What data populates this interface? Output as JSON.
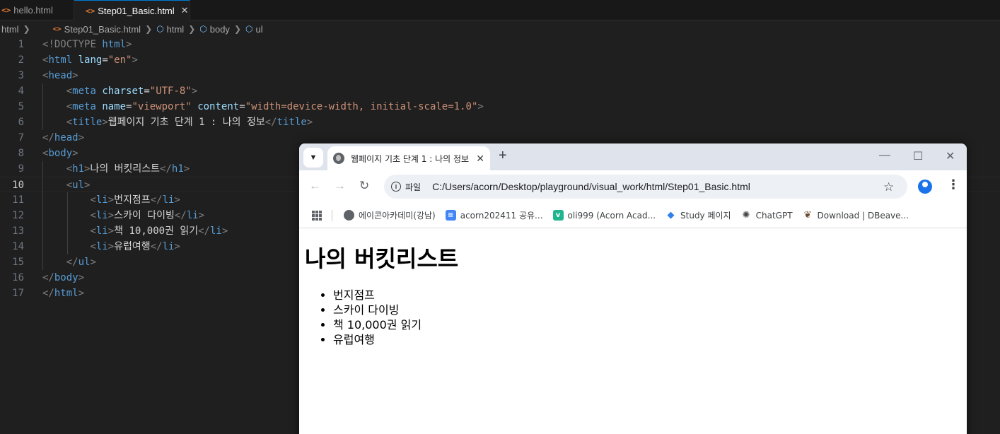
{
  "editor": {
    "tabs": [
      {
        "label": "hello.html",
        "icon": "html-file-icon",
        "active": false
      },
      {
        "label": "Step01_Basic.html",
        "icon": "html-file-icon",
        "active": true
      }
    ],
    "breadcrumb": [
      "html",
      "Step01_Basic.html",
      "html",
      "body",
      "ul"
    ],
    "current_line": 10,
    "lines": [
      "1",
      "2",
      "3",
      "4",
      "5",
      "6",
      "7",
      "8",
      "9",
      "10",
      "11",
      "12",
      "13",
      "14",
      "15",
      "16",
      "17"
    ],
    "code": {
      "doctype_kw": "!DOCTYPE",
      "html": "html",
      "lang_attr": "lang",
      "lang_val": "\"en\"",
      "head": "head",
      "meta": "meta",
      "charset_attr": "charset",
      "charset_val": "\"UTF-8\"",
      "name_attr": "name",
      "name_val": "\"viewport\"",
      "content_attr": "content",
      "content_val": "\"width=device-width, initial-scale=1.0\"",
      "title_tag": "title",
      "title_text": "웹페이지 기초 단계 1 : 나의 정보",
      "body": "body",
      "h1": "h1",
      "h1_text": "나의 버킷리스트",
      "ul": "ul",
      "li": "li",
      "items": [
        "번지점프",
        "스카이 다이빙",
        "책 10,000권 읽기",
        "유럽여행"
      ]
    }
  },
  "browser": {
    "tab_title": "웹페이지 기초 단계 1 : 나의 정보",
    "url_scheme": "파일",
    "url": "C:/Users/acorn/Desktop/playground/visual_work/html/Step01_Basic.html",
    "bookmarks": [
      {
        "label": "에이콘아카데미(강남)",
        "icon": "globe-icon",
        "color": "#5f6368"
      },
      {
        "label": "acorn202411 공유...",
        "icon": "docs-icon",
        "color": "#4285f4"
      },
      {
        "label": "oli999 (Acorn Acad...",
        "icon": "vue-icon",
        "color": "#1fb58f"
      },
      {
        "label": "Study 페이지",
        "icon": "diamond-icon",
        "color": "#2f80ed"
      },
      {
        "label": "ChatGPT",
        "icon": "chatgpt-icon",
        "color": "#444444"
      },
      {
        "label": "Download | DBeave...",
        "icon": "dbeaver-icon",
        "color": "#6b4a2b"
      }
    ],
    "page": {
      "heading": "나의 버킷리스트",
      "items": [
        "번지점프",
        "스카이 다이빙",
        "책 10,000권 읽기",
        "유럽여행"
      ]
    }
  }
}
